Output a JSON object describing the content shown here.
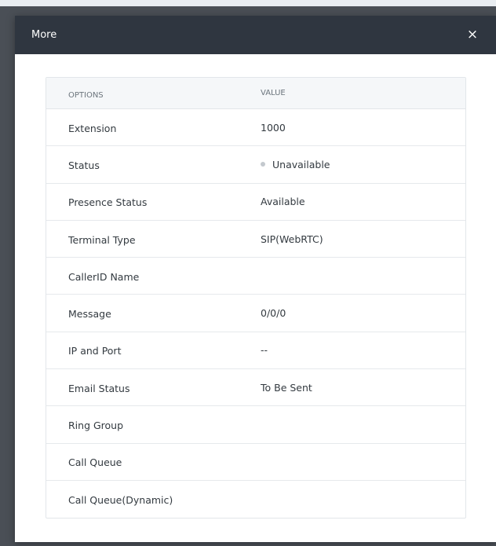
{
  "dialog": {
    "title": "More",
    "close_label": "×"
  },
  "table": {
    "headers": {
      "options": "OPTIONS",
      "value": "VALUE"
    },
    "rows": [
      {
        "option": "Extension",
        "value": "1000"
      },
      {
        "option": "Status",
        "value": "Unavailable",
        "status_dot_color": "#c4c9ce"
      },
      {
        "option": "Presence Status",
        "value": "Available"
      },
      {
        "option": "Terminal Type",
        "value": "SIP(WebRTC)"
      },
      {
        "option": "CallerID Name",
        "value": ""
      },
      {
        "option": "Message",
        "value": "0/0/0"
      },
      {
        "option": "IP and Port",
        "value": "--"
      },
      {
        "option": "Email Status",
        "value": "To Be Sent"
      },
      {
        "option": "Ring Group",
        "value": ""
      },
      {
        "option": "Call Queue",
        "value": ""
      },
      {
        "option": "Call Queue(Dynamic)",
        "value": ""
      }
    ]
  }
}
